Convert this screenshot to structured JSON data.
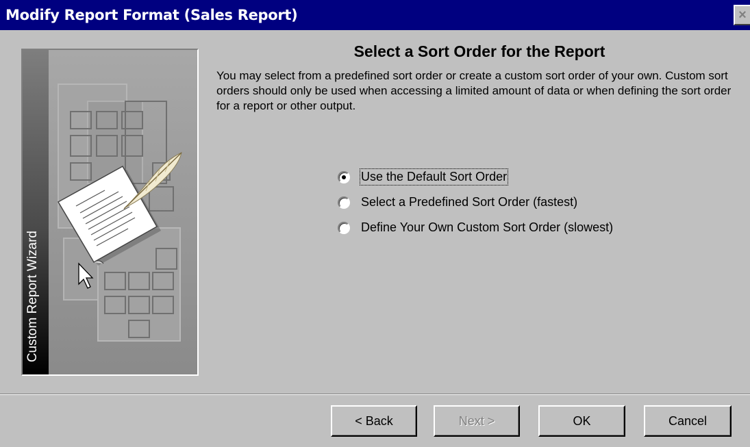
{
  "window": {
    "title": "Modify Report Format (Sales Report)",
    "close_symbol": "×"
  },
  "wizard": {
    "side_label": "Custom Report Wizard",
    "image_icon": "report-wizard-illustration"
  },
  "main": {
    "heading": "Select a Sort Order for the Report",
    "description": "You may select from a predefined sort order or create a custom sort order of your own. Custom sort orders should only be used when accessing a limited amount of data or when defining the sort order for a report or other output.",
    "options": [
      {
        "label": "Use the Default Sort Order",
        "checked": true
      },
      {
        "label": "Select a Predefined Sort Order (fastest)",
        "checked": false
      },
      {
        "label": "Define Your Own Custom Sort Order (slowest)",
        "checked": false
      }
    ]
  },
  "buttons": {
    "back": "< Back",
    "next": "Next >",
    "ok": "OK",
    "cancel": "Cancel"
  }
}
